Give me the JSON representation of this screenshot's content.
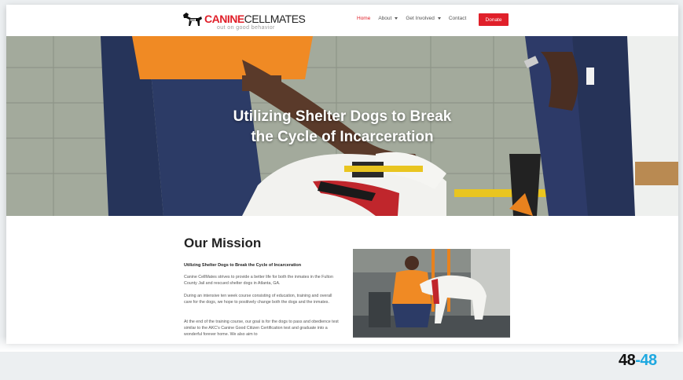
{
  "nav": {
    "logo_brand_red": "CANINE",
    "logo_brand_dark": "CELLMATES",
    "logo_tagline": "out on good behavior",
    "items": [
      {
        "label": "Home",
        "active": true,
        "dropdown": false
      },
      {
        "label": "About",
        "active": false,
        "dropdown": true
      },
      {
        "label": "Get Involved",
        "active": false,
        "dropdown": true
      },
      {
        "label": "Contact",
        "active": false,
        "dropdown": false
      }
    ],
    "donate_label": "Donate"
  },
  "hero": {
    "title_line1": "Utilizing Shelter Dogs to Break",
    "title_line2": "the Cycle of Incarceration"
  },
  "mission": {
    "heading": "Our Mission",
    "subheading": "Utilizing Shelter Dogs to Break the Cycle of Incarceration",
    "paragraphs": [
      "Canine CellMates strives to provide a better life for both the inmates in the Fulton County Jail and rescued shelter dogs in Atlanta, GA.",
      "During an intensive ten week course consisting of education, training and overall care for the dogs, we hope to positively change both the dogs and the inmates.",
      "At the end of the training course, our goal is for the dogs to pass and obedience test similar to the AKC's Canine Good Citizen Certification test and graduate into a wonderful forever home. We also aim to"
    ]
  },
  "watermark": {
    "part1": "48",
    "part2": "-48"
  },
  "colors": {
    "accent": "#e0202a",
    "watermark_blue": "#1ea8e0"
  }
}
